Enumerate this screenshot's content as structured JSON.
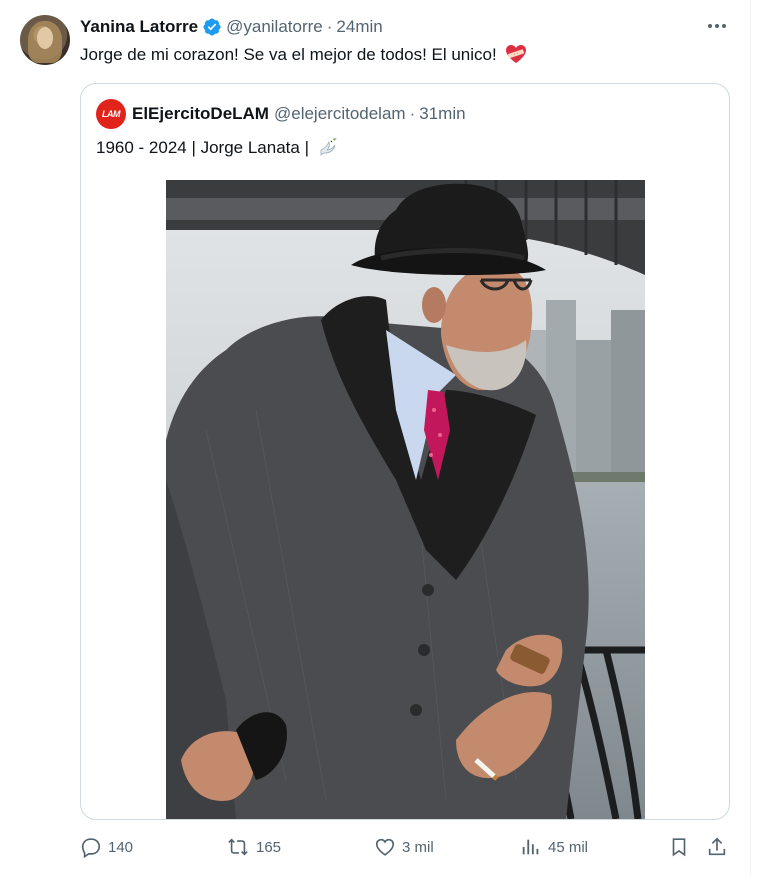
{
  "author": {
    "name": "Yanina Latorre",
    "handle": "@yanilatorre",
    "separator": "·",
    "time": "24min",
    "verified": true
  },
  "tweet": {
    "text": "Jorge de mi corazon! Se va el mejor de todos! El unico!",
    "emoji": "heart-with-bandage"
  },
  "quote": {
    "avatar_text": "LAM",
    "name": "ElEjercitoDeLAM",
    "handle": "@elejercitodelam",
    "separator": "·",
    "time": "31min",
    "text": "1960 - 2024 | Jorge Lanata |",
    "emoji": "dove"
  },
  "actions": {
    "replies": "140",
    "reposts": "165",
    "likes": "3 mil",
    "views": "45 mil"
  },
  "colors": {
    "text": "#0f1419",
    "secondary": "#536471",
    "border": "#cfd9de",
    "verified": "#1d9bf0",
    "lam_red": "#e0241c"
  }
}
